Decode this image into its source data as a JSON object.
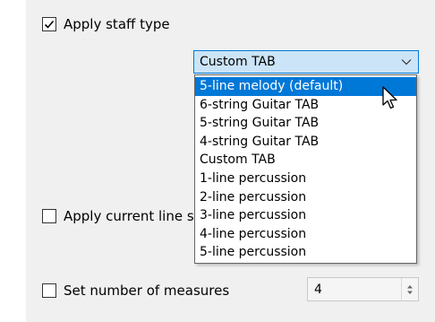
{
  "apply_staff_type": {
    "label": "Apply staff type",
    "checked": true
  },
  "staff_type_combo": {
    "value": "Custom TAB"
  },
  "staff_type_options": [
    "5-line melody (default)",
    "6-string Guitar TAB",
    "5-string Guitar TAB",
    "4-string Guitar TAB",
    "Custom TAB",
    "1-line percussion",
    "2-line percussion",
    "3-line percussion",
    "4-line percussion",
    "5-line percussion"
  ],
  "highlighted_option": "5-line melody (default)",
  "apply_line_spacing": {
    "label": "Apply current line s",
    "checked": false
  },
  "set_number_of_measures": {
    "label": "Set number of measures",
    "checked": false,
    "value": "4"
  },
  "colors": {
    "panel": "#f0f0f0",
    "combo_background": "#cce4f7",
    "focus_border": "#0078d7",
    "selection": "#0078d7"
  },
  "icons": [
    "checkmark-icon",
    "chevron-down-icon",
    "spinner-arrows-icon",
    "arrow-cursor-icon"
  ]
}
